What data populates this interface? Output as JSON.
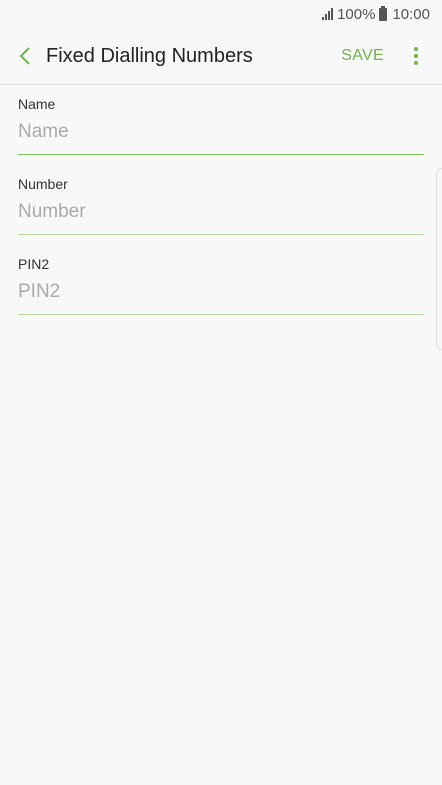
{
  "status": {
    "battery": "100%",
    "time": "10:00"
  },
  "appbar": {
    "title": "Fixed Dialling Numbers",
    "save_label": "SAVE"
  },
  "fields": [
    {
      "label": "Name",
      "placeholder": "Name",
      "value": ""
    },
    {
      "label": "Number",
      "placeholder": "Number",
      "value": ""
    },
    {
      "label": "PIN2",
      "placeholder": "PIN2",
      "value": ""
    }
  ],
  "colors": {
    "accent": "#6cb64a",
    "background": "#f8f8f8"
  }
}
